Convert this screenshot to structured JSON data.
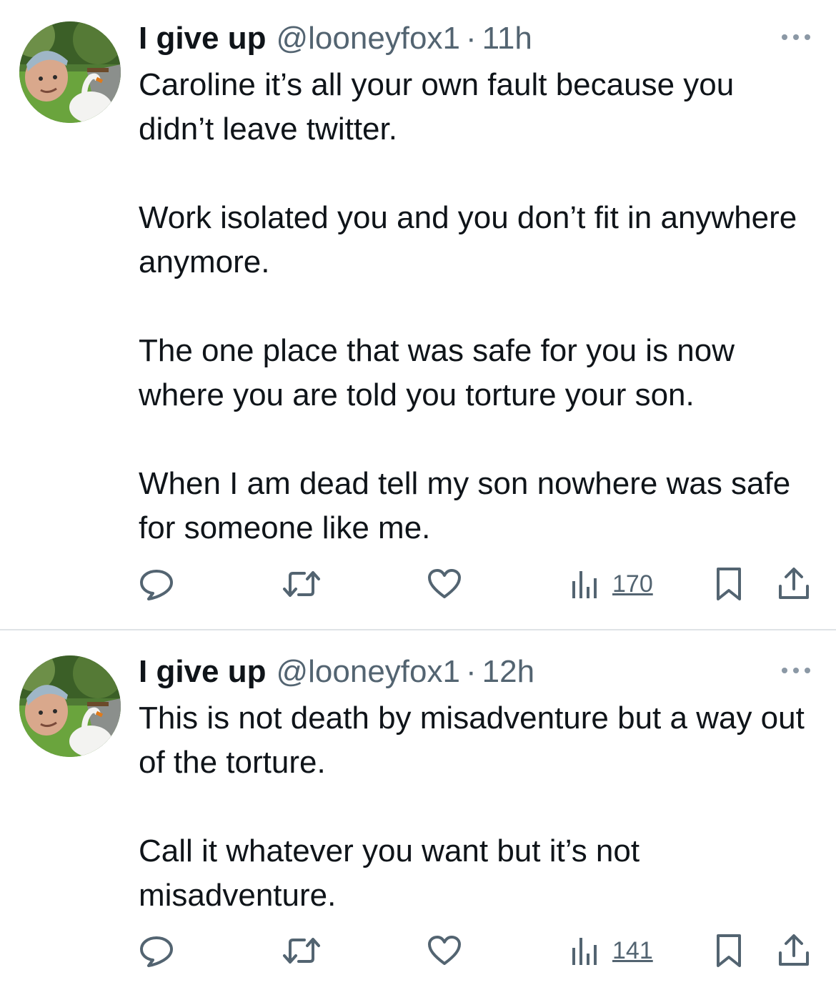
{
  "tweets": [
    {
      "display_name": "I give up",
      "handle": "@looneyfox1",
      "separator": "·",
      "time": "11h",
      "paragraphs": [
        "Caroline it’s all your own fault because you didn’t leave twitter.",
        "Work isolated you and you don’t fit in anywhere anymore.",
        "The one place that was safe for you is now where you are told you torture your son.",
        "When I am dead tell my son nowhere was safe for someone like me."
      ],
      "views": "170"
    },
    {
      "display_name": "I give up",
      "handle": "@looneyfox1",
      "separator": "·",
      "time": "12h",
      "paragraphs": [
        "This is not death by misadventure but a way out of the torture.",
        "Call it whatever you want but it’s not misadventure."
      ],
      "views": "141"
    }
  ],
  "icons": {
    "reply": "reply-icon",
    "retweet": "retweet-icon",
    "like": "heart-icon",
    "views": "analytics-icon",
    "bookmark": "bookmark-icon",
    "share": "share-icon",
    "more": "more-dots-icon"
  },
  "colors": {
    "text": "#0f1419",
    "secondary": "#536471",
    "divider": "#dfe3e6"
  }
}
